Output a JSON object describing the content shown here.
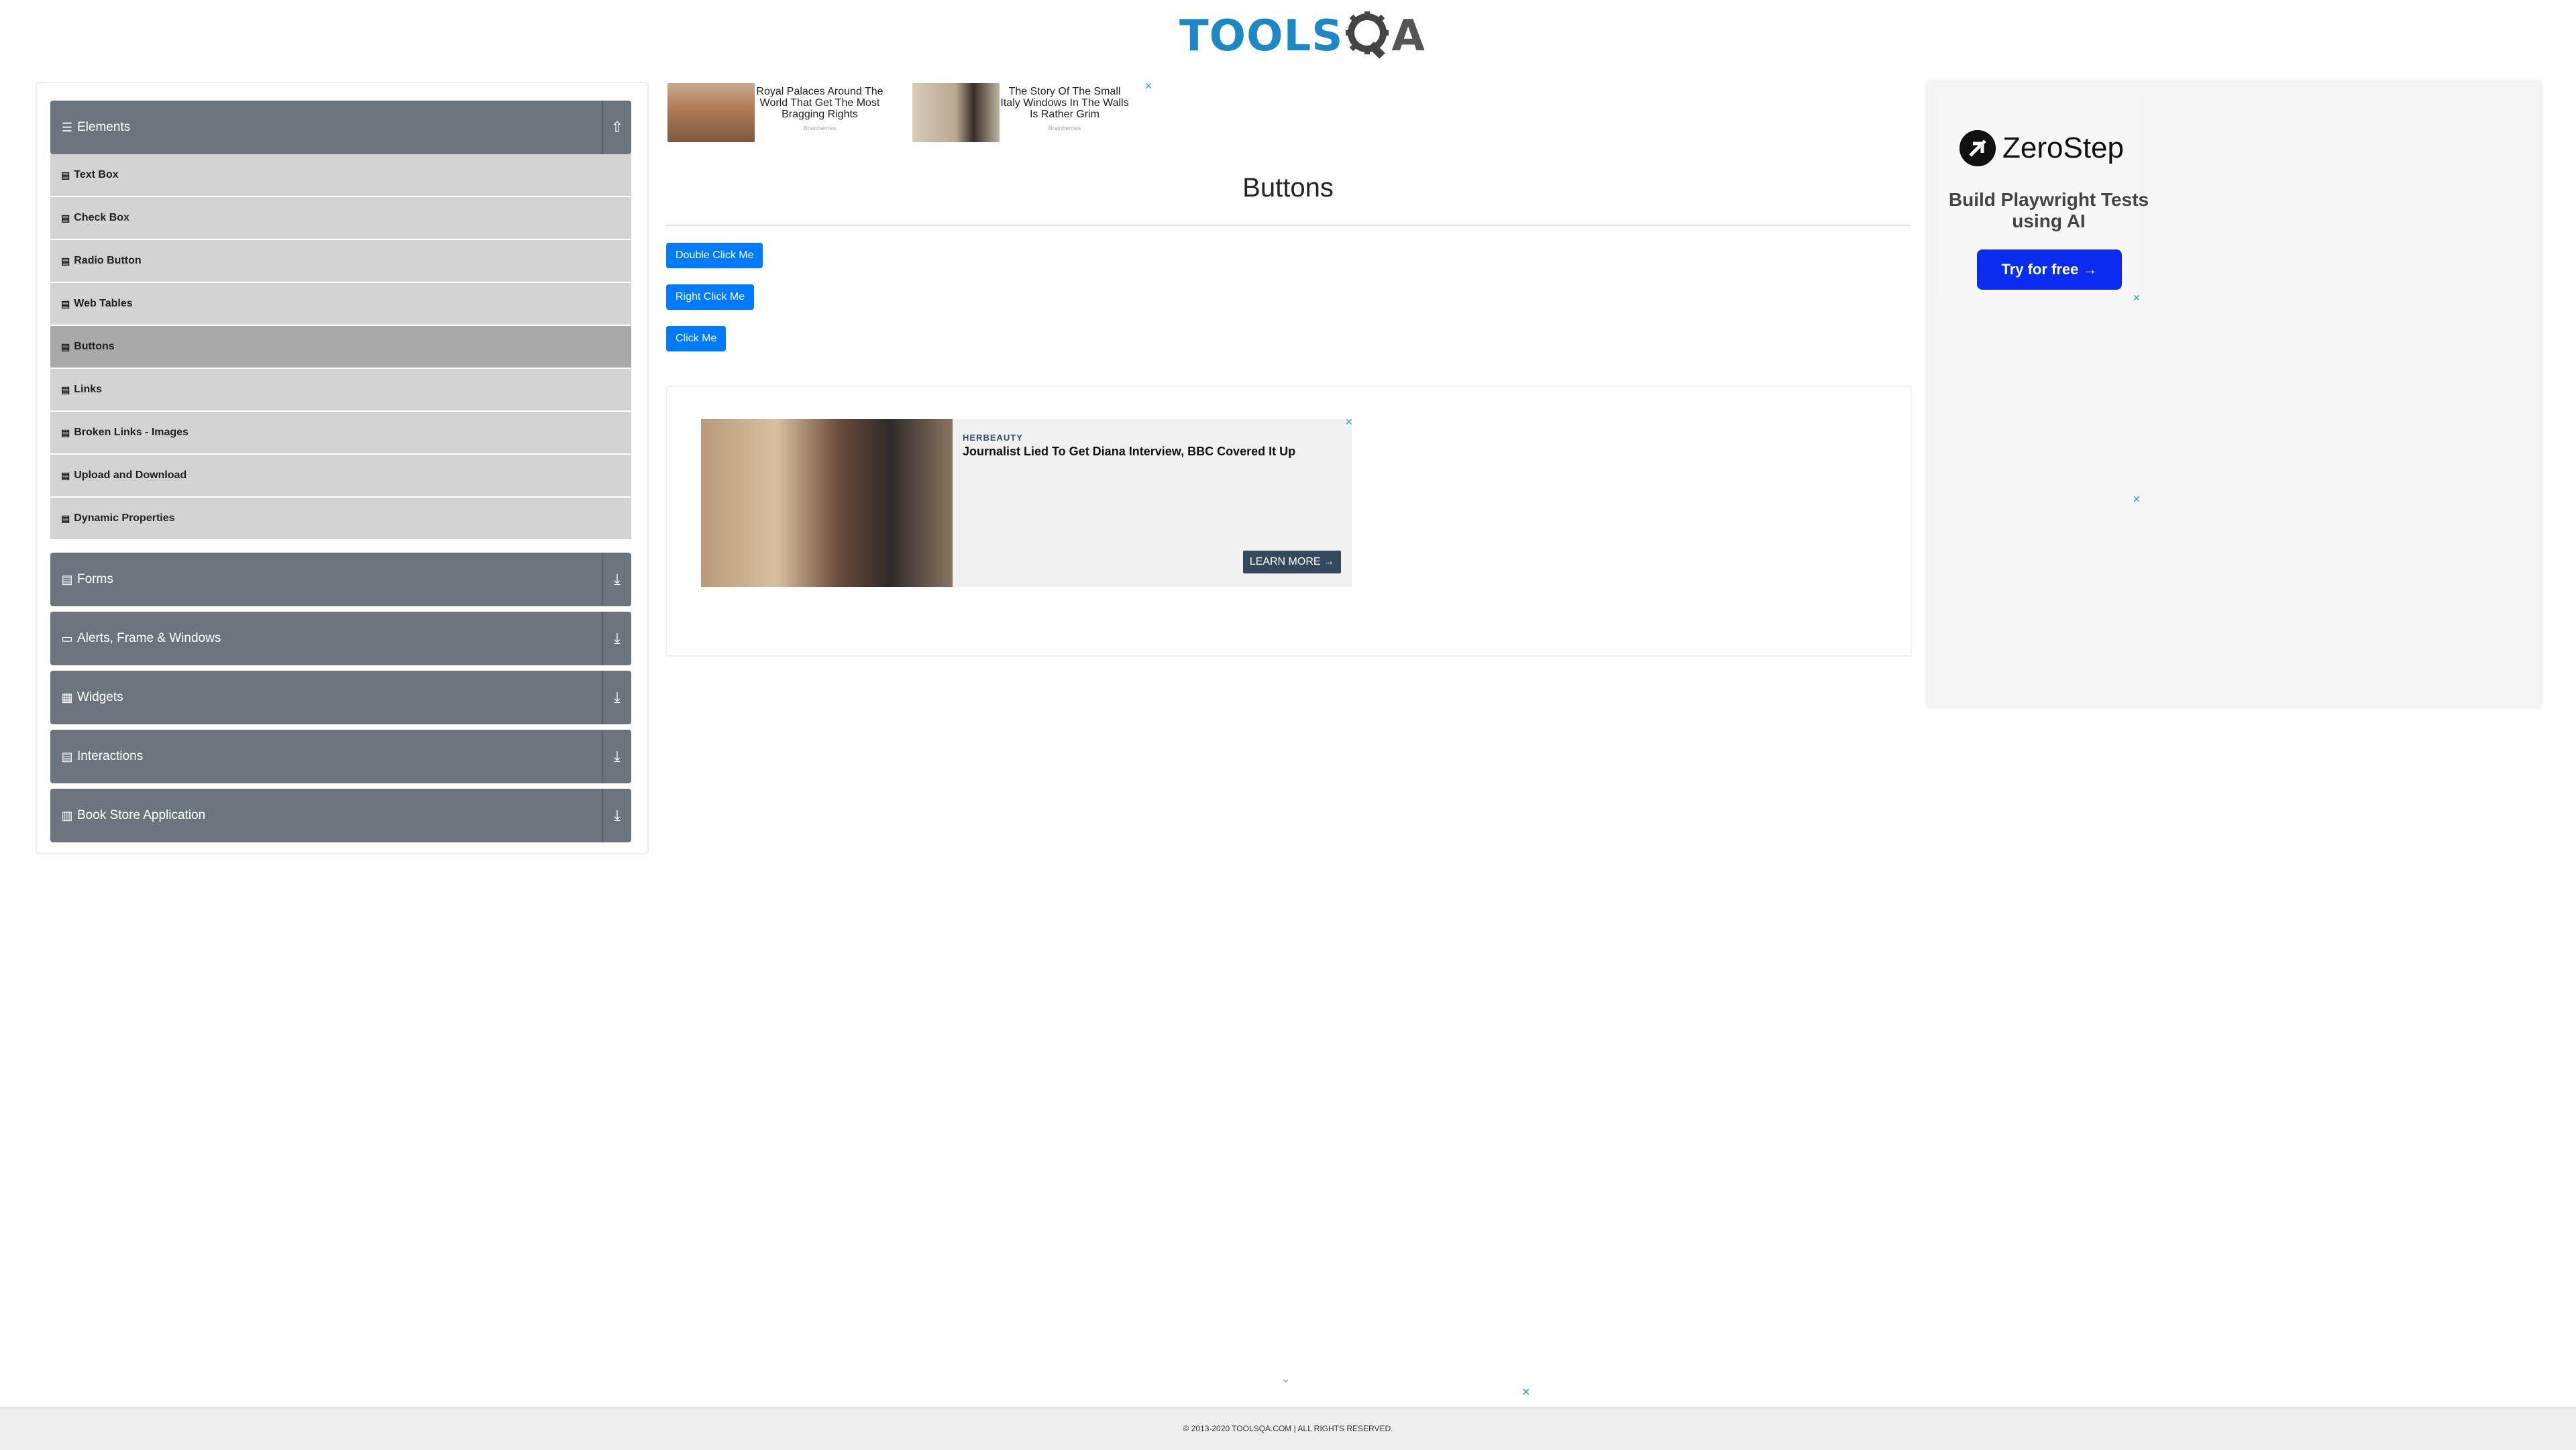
{
  "header": {
    "logo_text": "TOOLS",
    "logo_suffix": "A"
  },
  "sidebar": {
    "groups": [
      {
        "title": "Elements",
        "icon": "hamburger-icon",
        "toggle": "⇧"
      },
      {
        "title": "Forms",
        "icon": "form-icon",
        "toggle": "⤓"
      },
      {
        "title": "Alerts, Frame & Windows",
        "icon": "window-icon",
        "toggle": "⤓"
      },
      {
        "title": "Widgets",
        "icon": "grid-icon",
        "toggle": "⤓"
      },
      {
        "title": "Interactions",
        "icon": "doc-icon",
        "toggle": "⤓"
      },
      {
        "title": "Book Store Application",
        "icon": "bookstore-icon",
        "toggle": "⤓"
      }
    ],
    "elements_items": [
      {
        "label": "Text Box"
      },
      {
        "label": "Check Box"
      },
      {
        "label": "Radio Button"
      },
      {
        "label": "Web Tables"
      },
      {
        "label": "Buttons",
        "active": true
      },
      {
        "label": "Links"
      },
      {
        "label": "Broken Links - Images"
      },
      {
        "label": "Upload and Download"
      },
      {
        "label": "Dynamic Properties"
      }
    ]
  },
  "top_ads": [
    {
      "caption": "Royal Palaces Around The World That Get The Most Bragging Rights",
      "source": "Brainberries"
    },
    {
      "caption": "The Story Of The Small Italy Windows In The Walls Is Rather Grim",
      "source": "Brainberries"
    }
  ],
  "main": {
    "title": "Buttons",
    "buttons": {
      "double_click": "Double Click Me",
      "right_click": "Right Click Me",
      "click": "Click Me"
    }
  },
  "herb_ad": {
    "brand": "HERBEAUTY",
    "headline": "Journalist Lied To Get Diana Interview, BBC Covered It Up",
    "cta": "LEARN MORE →"
  },
  "right_ad": {
    "brand": "ZeroStep",
    "tagline": "Build Playwright Tests using AI",
    "cta": "Try for free →"
  },
  "footer": {
    "text": "© 2013-2020 TOOLSQA.COM | ALL RIGHTS RESERVED."
  },
  "colors": {
    "accent": "#007bff",
    "sidebar_group": "#6c757d",
    "menu_item": "#d3d3d3",
    "menu_active": "#a9a9a9",
    "logo_blue": "#1e88c7"
  }
}
